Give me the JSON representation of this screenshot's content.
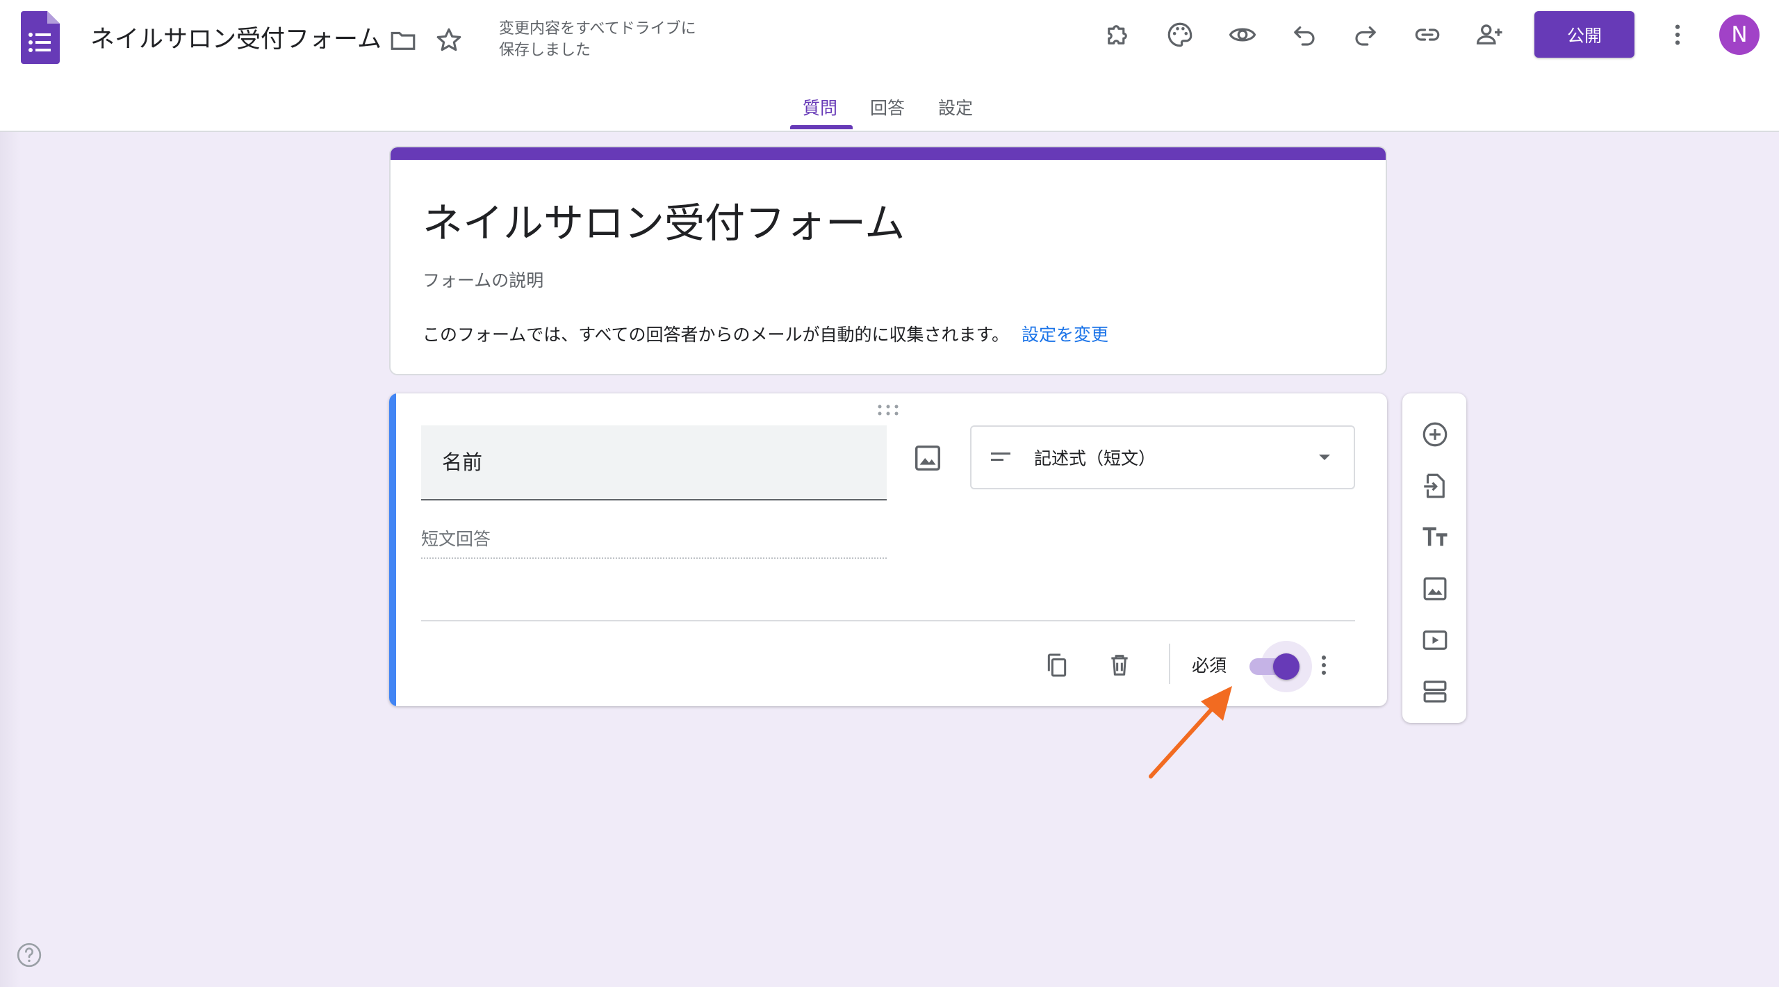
{
  "header": {
    "doc_title": "ネイルサロン受付フォーム",
    "save_status_line1": "変更内容をすべてドライブに",
    "save_status_line2": "保存しました",
    "publish_label": "公開",
    "avatar_initial": "N",
    "icons": [
      "folder-icon",
      "star-icon",
      "addon-icon",
      "palette-icon",
      "preview-icon",
      "undo-icon",
      "redo-icon",
      "link-icon",
      "add-collaborator-icon",
      "more-vert-icon"
    ]
  },
  "tabs": [
    {
      "label": "質問",
      "active": true
    },
    {
      "label": "回答",
      "active": false
    },
    {
      "label": "設定",
      "active": false
    }
  ],
  "form": {
    "title": "ネイルサロン受付フォーム",
    "description_placeholder": "フォームの説明",
    "email_notice": "このフォームでは、すべての回答者からのメールが自動的に収集されます。",
    "settings_link": "設定を変更"
  },
  "question": {
    "title": "名前",
    "type_label": "記述式（短文）",
    "answer_placeholder": "短文回答",
    "required_label": "必須",
    "required": true
  },
  "side_toolbar": [
    "add-question-icon",
    "import-questions-icon",
    "add-title-icon",
    "add-image-icon",
    "add-video-icon",
    "add-section-icon"
  ],
  "colors": {
    "accent": "#673ab7",
    "background": "#f0ebf8",
    "link": "#1a73e8",
    "question_bar": "#4285f4",
    "annotation_arrow": "#f26b21"
  }
}
